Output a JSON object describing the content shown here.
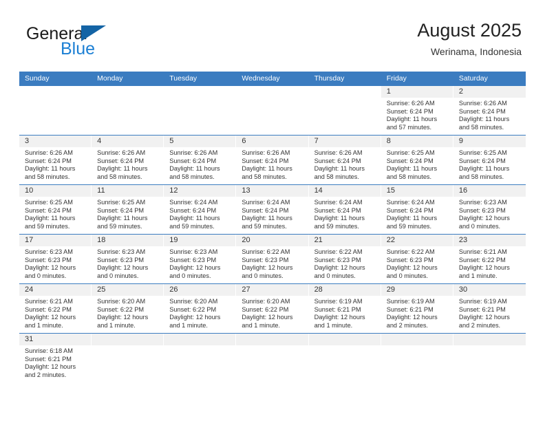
{
  "brand": {
    "name_part1": "General",
    "name_part2": "Blue",
    "color_dark": "#1a1a1a",
    "color_blue": "#1b7fd4",
    "triangle_color": "#1464a5"
  },
  "header": {
    "title": "August 2025",
    "subtitle": "Werinama, Indonesia",
    "header_bg": "#3b7cc0",
    "daynum_bg": "#f1f1f1"
  },
  "weekdays": [
    "Sunday",
    "Monday",
    "Tuesday",
    "Wednesday",
    "Thursday",
    "Friday",
    "Saturday"
  ],
  "weeks": [
    [
      {
        "day": "",
        "sunrise": "",
        "sunset": "",
        "daylight": ""
      },
      {
        "day": "",
        "sunrise": "",
        "sunset": "",
        "daylight": ""
      },
      {
        "day": "",
        "sunrise": "",
        "sunset": "",
        "daylight": ""
      },
      {
        "day": "",
        "sunrise": "",
        "sunset": "",
        "daylight": ""
      },
      {
        "day": "",
        "sunrise": "",
        "sunset": "",
        "daylight": ""
      },
      {
        "day": "1",
        "sunrise": "Sunrise: 6:26 AM",
        "sunset": "Sunset: 6:24 PM",
        "daylight": "Daylight: 11 hours and 57 minutes."
      },
      {
        "day": "2",
        "sunrise": "Sunrise: 6:26 AM",
        "sunset": "Sunset: 6:24 PM",
        "daylight": "Daylight: 11 hours and 58 minutes."
      }
    ],
    [
      {
        "day": "3",
        "sunrise": "Sunrise: 6:26 AM",
        "sunset": "Sunset: 6:24 PM",
        "daylight": "Daylight: 11 hours and 58 minutes."
      },
      {
        "day": "4",
        "sunrise": "Sunrise: 6:26 AM",
        "sunset": "Sunset: 6:24 PM",
        "daylight": "Daylight: 11 hours and 58 minutes."
      },
      {
        "day": "5",
        "sunrise": "Sunrise: 6:26 AM",
        "sunset": "Sunset: 6:24 PM",
        "daylight": "Daylight: 11 hours and 58 minutes."
      },
      {
        "day": "6",
        "sunrise": "Sunrise: 6:26 AM",
        "sunset": "Sunset: 6:24 PM",
        "daylight": "Daylight: 11 hours and 58 minutes."
      },
      {
        "day": "7",
        "sunrise": "Sunrise: 6:26 AM",
        "sunset": "Sunset: 6:24 PM",
        "daylight": "Daylight: 11 hours and 58 minutes."
      },
      {
        "day": "8",
        "sunrise": "Sunrise: 6:25 AM",
        "sunset": "Sunset: 6:24 PM",
        "daylight": "Daylight: 11 hours and 58 minutes."
      },
      {
        "day": "9",
        "sunrise": "Sunrise: 6:25 AM",
        "sunset": "Sunset: 6:24 PM",
        "daylight": "Daylight: 11 hours and 58 minutes."
      }
    ],
    [
      {
        "day": "10",
        "sunrise": "Sunrise: 6:25 AM",
        "sunset": "Sunset: 6:24 PM",
        "daylight": "Daylight: 11 hours and 59 minutes."
      },
      {
        "day": "11",
        "sunrise": "Sunrise: 6:25 AM",
        "sunset": "Sunset: 6:24 PM",
        "daylight": "Daylight: 11 hours and 59 minutes."
      },
      {
        "day": "12",
        "sunrise": "Sunrise: 6:24 AM",
        "sunset": "Sunset: 6:24 PM",
        "daylight": "Daylight: 11 hours and 59 minutes."
      },
      {
        "day": "13",
        "sunrise": "Sunrise: 6:24 AM",
        "sunset": "Sunset: 6:24 PM",
        "daylight": "Daylight: 11 hours and 59 minutes."
      },
      {
        "day": "14",
        "sunrise": "Sunrise: 6:24 AM",
        "sunset": "Sunset: 6:24 PM",
        "daylight": "Daylight: 11 hours and 59 minutes."
      },
      {
        "day": "15",
        "sunrise": "Sunrise: 6:24 AM",
        "sunset": "Sunset: 6:24 PM",
        "daylight": "Daylight: 11 hours and 59 minutes."
      },
      {
        "day": "16",
        "sunrise": "Sunrise: 6:23 AM",
        "sunset": "Sunset: 6:23 PM",
        "daylight": "Daylight: 12 hours and 0 minutes."
      }
    ],
    [
      {
        "day": "17",
        "sunrise": "Sunrise: 6:23 AM",
        "sunset": "Sunset: 6:23 PM",
        "daylight": "Daylight: 12 hours and 0 minutes."
      },
      {
        "day": "18",
        "sunrise": "Sunrise: 6:23 AM",
        "sunset": "Sunset: 6:23 PM",
        "daylight": "Daylight: 12 hours and 0 minutes."
      },
      {
        "day": "19",
        "sunrise": "Sunrise: 6:23 AM",
        "sunset": "Sunset: 6:23 PM",
        "daylight": "Daylight: 12 hours and 0 minutes."
      },
      {
        "day": "20",
        "sunrise": "Sunrise: 6:22 AM",
        "sunset": "Sunset: 6:23 PM",
        "daylight": "Daylight: 12 hours and 0 minutes."
      },
      {
        "day": "21",
        "sunrise": "Sunrise: 6:22 AM",
        "sunset": "Sunset: 6:23 PM",
        "daylight": "Daylight: 12 hours and 0 minutes."
      },
      {
        "day": "22",
        "sunrise": "Sunrise: 6:22 AM",
        "sunset": "Sunset: 6:23 PM",
        "daylight": "Daylight: 12 hours and 0 minutes."
      },
      {
        "day": "23",
        "sunrise": "Sunrise: 6:21 AM",
        "sunset": "Sunset: 6:22 PM",
        "daylight": "Daylight: 12 hours and 1 minute."
      }
    ],
    [
      {
        "day": "24",
        "sunrise": "Sunrise: 6:21 AM",
        "sunset": "Sunset: 6:22 PM",
        "daylight": "Daylight: 12 hours and 1 minute."
      },
      {
        "day": "25",
        "sunrise": "Sunrise: 6:20 AM",
        "sunset": "Sunset: 6:22 PM",
        "daylight": "Daylight: 12 hours and 1 minute."
      },
      {
        "day": "26",
        "sunrise": "Sunrise: 6:20 AM",
        "sunset": "Sunset: 6:22 PM",
        "daylight": "Daylight: 12 hours and 1 minute."
      },
      {
        "day": "27",
        "sunrise": "Sunrise: 6:20 AM",
        "sunset": "Sunset: 6:22 PM",
        "daylight": "Daylight: 12 hours and 1 minute."
      },
      {
        "day": "28",
        "sunrise": "Sunrise: 6:19 AM",
        "sunset": "Sunset: 6:21 PM",
        "daylight": "Daylight: 12 hours and 1 minute."
      },
      {
        "day": "29",
        "sunrise": "Sunrise: 6:19 AM",
        "sunset": "Sunset: 6:21 PM",
        "daylight": "Daylight: 12 hours and 2 minutes."
      },
      {
        "day": "30",
        "sunrise": "Sunrise: 6:19 AM",
        "sunset": "Sunset: 6:21 PM",
        "daylight": "Daylight: 12 hours and 2 minutes."
      }
    ],
    [
      {
        "day": "31",
        "sunrise": "Sunrise: 6:18 AM",
        "sunset": "Sunset: 6:21 PM",
        "daylight": "Daylight: 12 hours and 2 minutes."
      },
      {
        "day": "",
        "sunrise": "",
        "sunset": "",
        "daylight": ""
      },
      {
        "day": "",
        "sunrise": "",
        "sunset": "",
        "daylight": ""
      },
      {
        "day": "",
        "sunrise": "",
        "sunset": "",
        "daylight": ""
      },
      {
        "day": "",
        "sunrise": "",
        "sunset": "",
        "daylight": ""
      },
      {
        "day": "",
        "sunrise": "",
        "sunset": "",
        "daylight": ""
      },
      {
        "day": "",
        "sunrise": "",
        "sunset": "",
        "daylight": ""
      }
    ]
  ]
}
